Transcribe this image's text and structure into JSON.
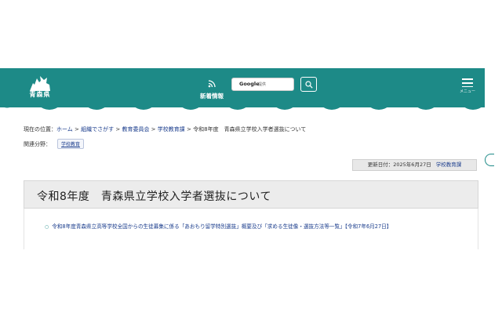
{
  "header": {
    "logo_text": "青森県",
    "news_label": "新着情報",
    "search_brand": "Google",
    "search_brand_sub": "提供",
    "menu_label": "メニュー"
  },
  "breadcrumb": {
    "prefix": "現在の位置：",
    "home": "ホーム",
    "sep": " > ",
    "level1": "組織でさがす",
    "level2": "教育委員会",
    "level3": "学校教育課",
    "current": "令和8年度　青森県立学校入学者選抜について"
  },
  "related": {
    "label": "関連分野：",
    "tag": "学校教育"
  },
  "updated": {
    "text": "更新日付：2025年6月27日",
    "department": "学校教育課"
  },
  "page": {
    "title": "令和8年度　青森県立学校入学者選抜について"
  },
  "links": [
    {
      "text": "令和8年度青森県立高等学校全国からの生徒募集に係る「あおもり留学特別選抜」概要及び「求める生徒像・選抜方法等一覧」【令和7年6月27日】"
    }
  ],
  "colors": {
    "header_bg": "#1d8a87",
    "link": "#1a3c8c"
  },
  "icons": {
    "logo": "aomori-prefecture-logo",
    "news": "rss-icon",
    "search": "search-icon",
    "menu": "hamburger-menu-icon"
  }
}
